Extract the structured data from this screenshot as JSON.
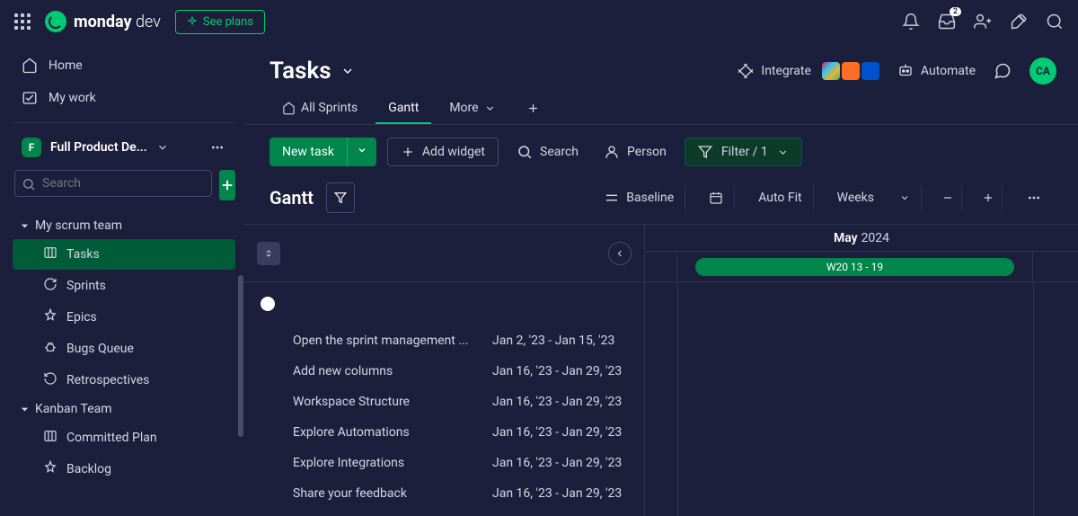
{
  "topbar": {
    "product_name_bold": "monday",
    "product_name_light": "dev",
    "see_plans": "See plans",
    "inbox_badge": "2"
  },
  "sidebar": {
    "home": "Home",
    "my_work": "My work",
    "workspace_initial": "F",
    "workspace": "Full Product De...",
    "search_placeholder": "Search",
    "groups": [
      {
        "name": "My scrum team",
        "items": [
          {
            "label": "Tasks",
            "icon": "board",
            "active": true
          },
          {
            "label": "Sprints",
            "icon": "sprint"
          },
          {
            "label": "Epics",
            "icon": "epic"
          },
          {
            "label": "Bugs Queue",
            "icon": "bug"
          },
          {
            "label": "Retrospectives",
            "icon": "retro"
          }
        ]
      },
      {
        "name": "Kanban Team",
        "items": [
          {
            "label": "Committed Plan",
            "icon": "board"
          },
          {
            "label": "Backlog",
            "icon": "epic"
          }
        ]
      }
    ]
  },
  "board": {
    "title": "Tasks",
    "integrate": "Integrate",
    "automate": "Automate",
    "avatar": "CA",
    "tabs": {
      "all_sprints": "All Sprints",
      "gantt": "Gantt",
      "more": "More"
    },
    "toolbar": {
      "new_task": "New task",
      "add_widget": "Add widget",
      "search": "Search",
      "person": "Person",
      "filter": "Filter / 1"
    },
    "gantt": {
      "title": "Gantt",
      "baseline": "Baseline",
      "auto_fit": "Auto Fit",
      "weeks": "Weeks",
      "month": "May",
      "year": "2024",
      "current_week": "W20 13 - 19",
      "tasks": [
        {
          "name": "Open the sprint management ...",
          "dates": "Jan 2, '23 - Jan 15, '23"
        },
        {
          "name": "Add new columns",
          "dates": "Jan 16, '23 - Jan 29, '23"
        },
        {
          "name": "Workspace Structure",
          "dates": "Jan 16, '23 - Jan 29, '23"
        },
        {
          "name": "Explore Automations",
          "dates": "Jan 16, '23 - Jan 29, '23"
        },
        {
          "name": "Explore Integrations",
          "dates": "Jan 16, '23 - Jan 29, '23"
        },
        {
          "name": "Share your feedback",
          "dates": "Jan 16, '23 - Jan 29, '23"
        }
      ]
    }
  }
}
